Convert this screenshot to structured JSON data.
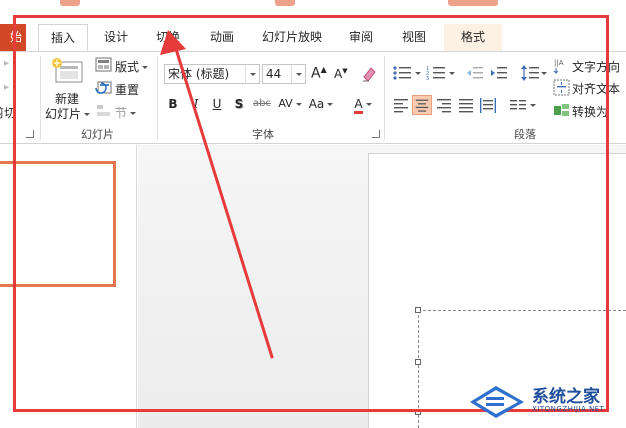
{
  "tabs": [
    {
      "label": "始",
      "key": "file"
    },
    {
      "label": "插入",
      "key": "insert"
    },
    {
      "label": "设计",
      "key": "design"
    },
    {
      "label": "切换",
      "key": "transitions"
    },
    {
      "label": "动画",
      "key": "animations"
    },
    {
      "label": "幻灯片放映",
      "key": "slideshow"
    },
    {
      "label": "审阅",
      "key": "review"
    },
    {
      "label": "视图",
      "key": "view"
    },
    {
      "label": "格式",
      "key": "format"
    }
  ],
  "slides_group": {
    "cut_label": "剪切",
    "new_slide_line1": "新建",
    "new_slide_line2": "幻灯片",
    "layout_label": "版式",
    "reset_label": "重置",
    "section_label": "节",
    "group_label": "幻灯片"
  },
  "font_group": {
    "font_name": "宋体 (标题)",
    "font_size": "44",
    "grow_label": "A",
    "shrink_label": "A",
    "bold": "B",
    "italic": "I",
    "underline": "U",
    "shadow": "S",
    "strike": "abc",
    "spacing": "AV",
    "case": "Aa",
    "color": "A",
    "group_label": "字体"
  },
  "paragraph_group": {
    "text_direction": "文字方向",
    "align_text": "对齐文本",
    "convert": "转换为",
    "group_label": "段落"
  },
  "watermark": {
    "title": "系统之家",
    "subtitle": "XITONGZHIJIA.NET"
  },
  "colors": {
    "accent_red": "#e63b3b",
    "file_tab": "#d24726",
    "thumb_border": "#e1784f",
    "context_tab": "#fdf1e3",
    "watermark_blue": "#1f4e9a"
  }
}
